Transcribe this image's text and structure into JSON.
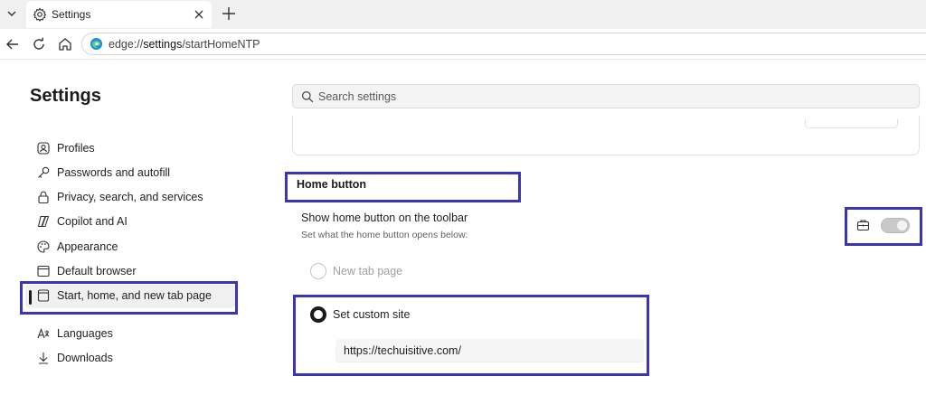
{
  "browser": {
    "tab": {
      "title": "Settings"
    },
    "address": {
      "url_scheme": "edge://",
      "url_path": "settings",
      "url_rest": "/startHomeNTP"
    }
  },
  "sidebar": {
    "title": "Settings",
    "items": [
      {
        "label": "Profiles",
        "icon": "profile-icon"
      },
      {
        "label": "Passwords and autofill",
        "icon": "key-icon"
      },
      {
        "label": "Privacy, search, and services",
        "icon": "lock-icon"
      },
      {
        "label": "Copilot and AI",
        "icon": "copilot-icon"
      },
      {
        "label": "Appearance",
        "icon": "palette-icon"
      },
      {
        "label": "Default browser",
        "icon": "browser-icon"
      },
      {
        "label": "Start, home, and new tab page",
        "icon": "home-page-icon",
        "active": true
      },
      {
        "label": "Languages",
        "icon": "languages-icon"
      },
      {
        "label": "Downloads",
        "icon": "download-icon"
      }
    ]
  },
  "search": {
    "placeholder": "Search settings"
  },
  "home_button": {
    "section_title": "Home button",
    "toggle_title": "Show home button on the toolbar",
    "toggle_subtitle": "Set what the home button opens below:",
    "toggle_on": true,
    "managed_icon": "briefcase-icon",
    "options": [
      {
        "label": "New tab page",
        "selected": false,
        "disabled": true
      },
      {
        "label": "Set custom site",
        "selected": true
      }
    ],
    "custom_site_value": "https://techuisitive.com/"
  },
  "colors": {
    "highlight": "#3b35b5",
    "text": "#1f1f1f",
    "disabled_text": "#a0a0a0"
  }
}
